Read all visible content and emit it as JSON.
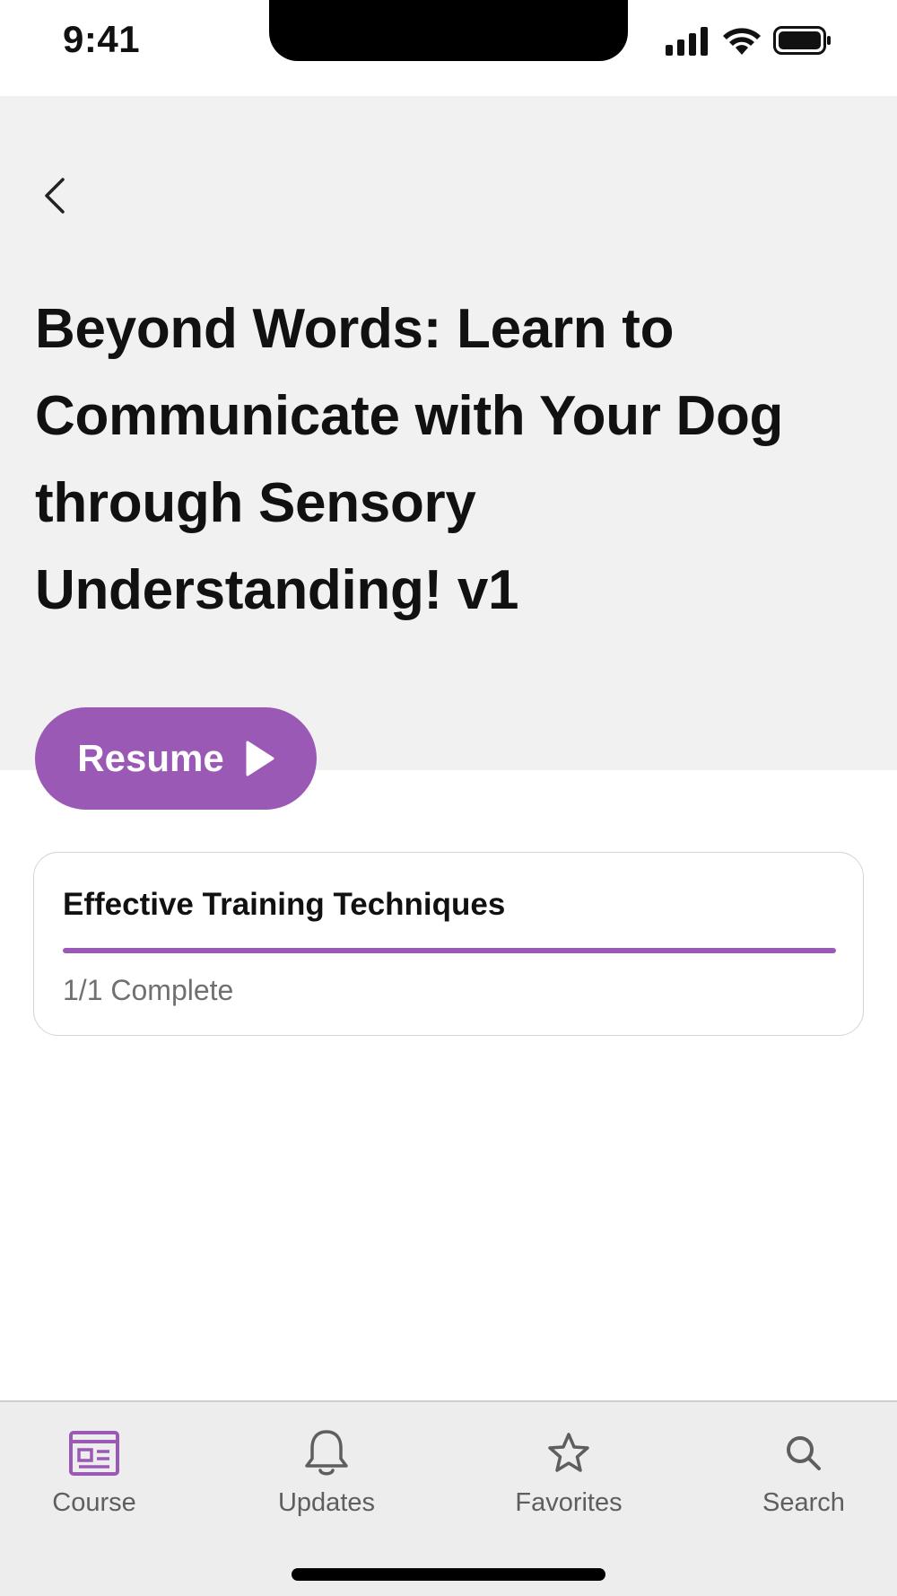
{
  "status_bar": {
    "time": "9:41"
  },
  "header": {
    "back_icon": "chevron-left-icon",
    "title": "Beyond Words: Learn to Communicate with Your Dog through Sensory Understanding! v1"
  },
  "resume": {
    "label": "Resume",
    "icon": "play-icon"
  },
  "module": {
    "title": "Effective Training Techniques",
    "completed": 1,
    "total": 1,
    "progress_fraction": 1.0,
    "status_text": "1/1 Complete"
  },
  "tab_bar": {
    "tabs": [
      {
        "label": "Course",
        "icon": "course-icon",
        "active": true
      },
      {
        "label": "Updates",
        "icon": "bell-icon",
        "active": false
      },
      {
        "label": "Favorites",
        "icon": "star-icon",
        "active": false
      },
      {
        "label": "Search",
        "icon": "search-icon",
        "active": false
      }
    ]
  },
  "colors": {
    "accent": "#9b59b6",
    "header_background": "#f1f1f1",
    "tab_bar_background": "#ededed",
    "inactive_icon": "#5e5e5e"
  }
}
